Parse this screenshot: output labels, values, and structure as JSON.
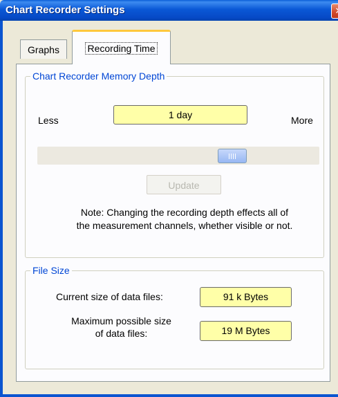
{
  "window": {
    "title": "Chart Recorder Settings",
    "close_symbol": "✕"
  },
  "tabs": [
    {
      "label": "Graphs",
      "selected": false
    },
    {
      "label": "Recording Time",
      "selected": true
    }
  ],
  "memory_group": {
    "legend": "Chart Recorder Memory Depth",
    "less_label": "Less",
    "more_label": "More",
    "depth_value": "1 day",
    "slider_level": 0.69,
    "update_label": "Update",
    "note_line1": "Note:  Changing the recording depth effects all of",
    "note_line2": "the measurement channels, whether visible or not."
  },
  "file_group": {
    "legend": "File Size",
    "current_label": "Current size of data files:",
    "current_value": "91 k Bytes",
    "max_label_line1": "Maximum possible size",
    "max_label_line2": "of data files:",
    "max_value": "19 M Bytes"
  },
  "colors": {
    "titlebar": "#0a58d6",
    "legend_text": "#0046d5",
    "value_box": "#ffffa8",
    "tab_highlight": "#ffc83c"
  }
}
